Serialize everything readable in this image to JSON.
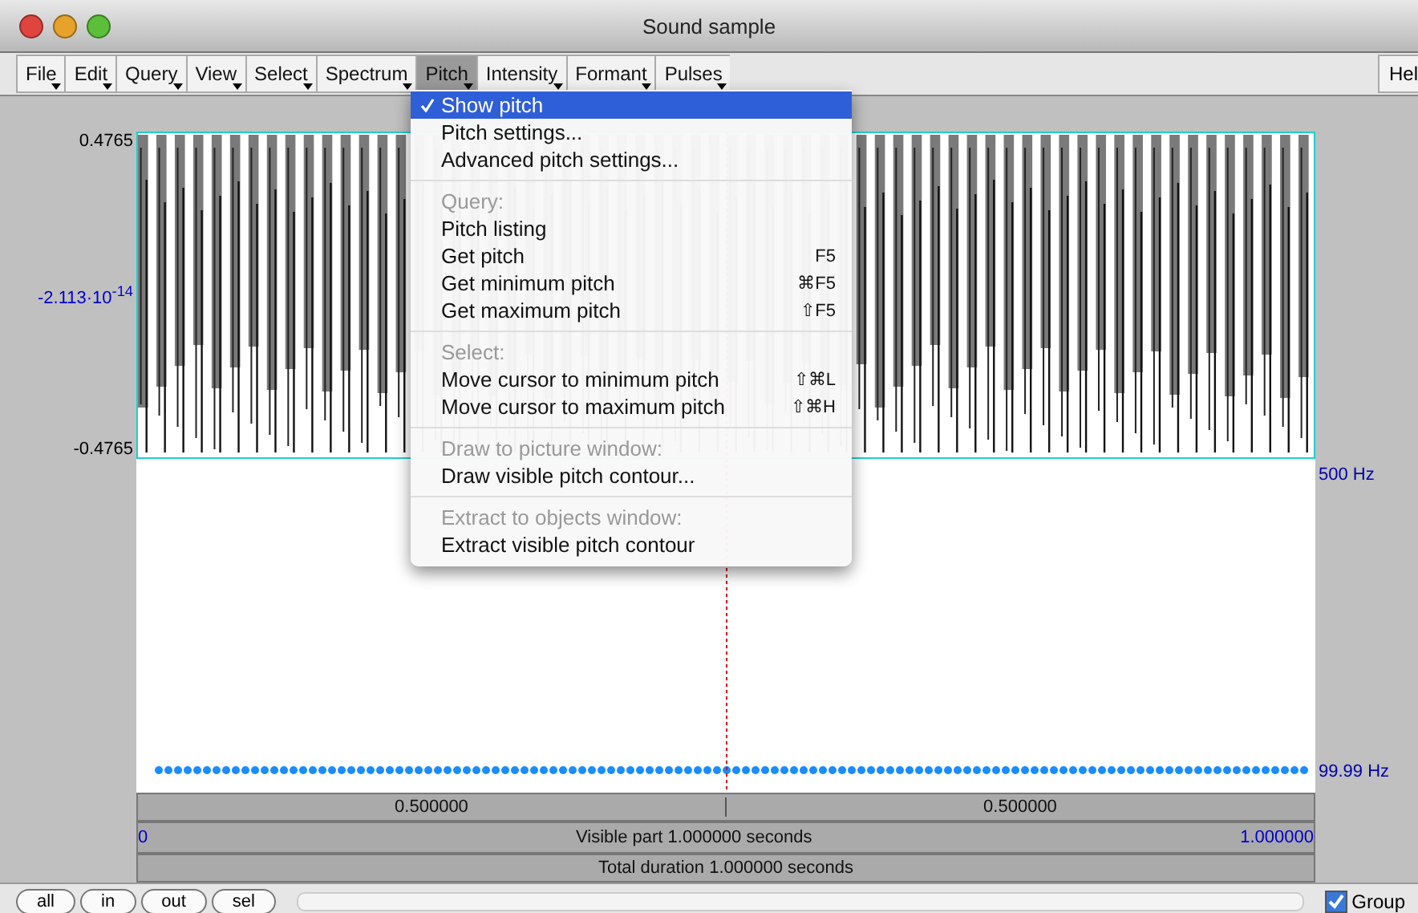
{
  "window": {
    "title": "Sound sample"
  },
  "menubar": [
    {
      "label": "File",
      "selected": false
    },
    {
      "label": "Edit",
      "selected": false
    },
    {
      "label": "Query",
      "selected": false
    },
    {
      "label": "View",
      "selected": false
    },
    {
      "label": "Select",
      "selected": false
    },
    {
      "label": "Spectrum",
      "selected": false
    },
    {
      "label": "Pitch",
      "selected": true
    },
    {
      "label": "Intensity",
      "selected": false
    },
    {
      "label": "Formant",
      "selected": false
    },
    {
      "label": "Pulses",
      "selected": false
    }
  ],
  "help_button": "Hel",
  "pitch_menu": [
    {
      "kind": "item",
      "label": "Show pitch",
      "checked": true,
      "highlighted": true
    },
    {
      "kind": "item",
      "label": "Pitch settings...",
      "checked": false,
      "highlighted": false
    },
    {
      "kind": "item",
      "label": "Advanced pitch settings...",
      "checked": false,
      "highlighted": false
    },
    {
      "kind": "separator"
    },
    {
      "kind": "header",
      "label": "Query:"
    },
    {
      "kind": "item",
      "label": "Pitch listing",
      "checked": false,
      "highlighted": false
    },
    {
      "kind": "item",
      "label": "Get pitch",
      "shortcut": "F5",
      "checked": false,
      "highlighted": false
    },
    {
      "kind": "item",
      "label": "Get minimum pitch",
      "shortcut": "⌘F5",
      "checked": false,
      "highlighted": false
    },
    {
      "kind": "item",
      "label": "Get maximum pitch",
      "shortcut": "⇧F5",
      "checked": false,
      "highlighted": false
    },
    {
      "kind": "separator"
    },
    {
      "kind": "header",
      "label": "Select:"
    },
    {
      "kind": "item",
      "label": "Move cursor to minimum pitch",
      "shortcut": "⇧⌘L",
      "checked": false,
      "highlighted": false
    },
    {
      "kind": "item",
      "label": "Move cursor to maximum pitch",
      "shortcut": "⇧⌘H",
      "checked": false,
      "highlighted": false
    },
    {
      "kind": "separator"
    },
    {
      "kind": "header",
      "label": "Draw to picture window:"
    },
    {
      "kind": "item",
      "label": "Draw visible pitch contour...",
      "checked": false,
      "highlighted": false
    },
    {
      "kind": "separator"
    },
    {
      "kind": "header",
      "label": "Extract to objects window:"
    },
    {
      "kind": "item",
      "label": "Extract visible pitch contour",
      "checked": false,
      "highlighted": false
    }
  ],
  "waveform": {
    "y_max": "0.4765",
    "y_mid": "-2.113·10$^{-14}$",
    "y_min": "-0.4765"
  },
  "pitch": {
    "top_label": "500 Hz",
    "bottom_label": "99.99 Hz"
  },
  "selection_bar": [
    "0.500000",
    "0.500000"
  ],
  "visible_bar": {
    "start": "0",
    "text": "Visible part 1.000000 seconds",
    "end": "1.000000"
  },
  "total_bar": "Total duration 1.000000 seconds",
  "zoom_buttons": [
    "all",
    "in",
    "out",
    "sel"
  ],
  "group": {
    "label": "Group",
    "checked": true
  }
}
